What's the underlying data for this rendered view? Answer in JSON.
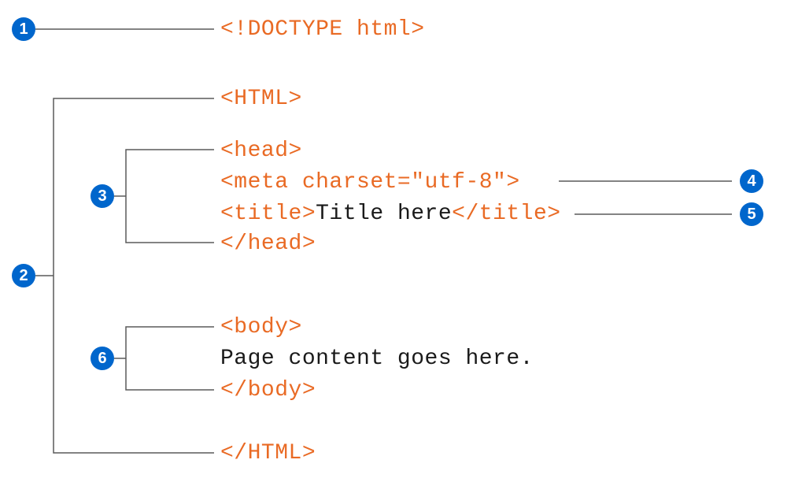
{
  "callouts": {
    "c1": "1",
    "c2": "2",
    "c3": "3",
    "c4": "4",
    "c5": "5",
    "c6": "6"
  },
  "code": {
    "l1": "<!DOCTYPE html>",
    "l2": "<HTML>",
    "l3": "<head>",
    "l4": "<meta charset=\"utf-8\">",
    "l5_open": "<title>",
    "l5_text": "Title here",
    "l5_close": "</title>",
    "l6": "</head>",
    "l7": "<body>",
    "l8": "Page content goes here.",
    "l9": "</body>",
    "l10": "</HTML>"
  },
  "colors": {
    "tag": "#e96a24",
    "text": "#1a1a1a",
    "bracket": "#5a5a5a",
    "callout_bg": "#0066cc",
    "callout_fg": "#ffffff"
  }
}
